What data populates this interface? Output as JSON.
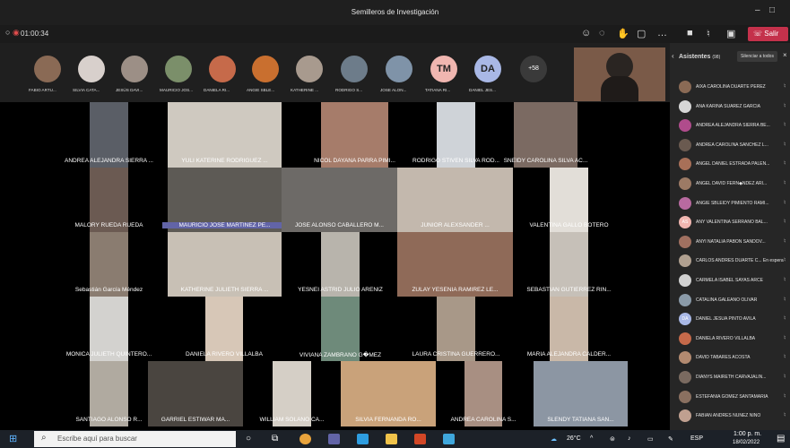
{
  "window": {
    "title": "Semilleros de Investigación"
  },
  "meeting": {
    "timer": "01:00:34",
    "leave_label": "Salir"
  },
  "strip": {
    "avatars": [
      {
        "label": "FABIO ARTU...",
        "color": "#8a6a55"
      },
      {
        "label": "SILVIA CATA...",
        "color": "#d8d0cc"
      },
      {
        "label": "JESÚS DAVI...",
        "color": "#9c8f86"
      },
      {
        "label": "MAURICIO JOS...",
        "color": "#7b8f6a"
      },
      {
        "label": "DANIELA RI...",
        "color": "#c66a4a"
      },
      {
        "label": "ANGIE SBLE...",
        "color": "#c96f2f"
      },
      {
        "label": "KATHERINE ...",
        "color": "#a89a8e"
      },
      {
        "label": "RODRIGO S...",
        "color": "#6d7c8a"
      },
      {
        "label": "JOSE ALON...",
        "color": "#7f93a8"
      },
      {
        "label": "TATIANA RI...",
        "initials": "TM",
        "color": "#f0b6b0"
      },
      {
        "label": "DANIEL JES...",
        "initials": "DA",
        "color": "#a9b8e6"
      }
    ],
    "more_count": "+58"
  },
  "tiles": [
    {
      "name": "ANDREA ALEJANDRA SIERRA ...",
      "color": "#5a5e66"
    },
    {
      "name": "YULI KATERINE RODRIGUEZ ...",
      "color": "#cfc9c0"
    },
    {
      "name": "NICOL DAYANA PARRA PIMI...",
      "color": "#a67c6a"
    },
    {
      "name": "RODRIGO STIVEN SILVA ROD...",
      "color": "#cfd3d8"
    },
    {
      "name": "SNEIDY CAROLINA SILVA AC...",
      "color": "#7b6a62"
    },
    {
      "name": "MALORY  RUEDA RUEDA",
      "color": "#6b5a52"
    },
    {
      "name": "MAURICIO JOSE MARTINEZ PE...",
      "color": "#5d5a55",
      "hl": true
    },
    {
      "name": "JOSE ALONSO CABALLERO M...",
      "color": "#6d6a67"
    },
    {
      "name": "JUNIOR ALEXSANDER ...",
      "color": "#c3b8ad"
    },
    {
      "name": "VALENTINA  GALLO BOTERO",
      "color": "#e2ded8"
    },
    {
      "name": "Sebastián  García Méndez",
      "color": "#8a7c70"
    },
    {
      "name": "KATHERINE JULIETH SIERRA ...",
      "color": "#c8c0b5"
    },
    {
      "name": "YESNEI ASTRID JULIO ARENIZ",
      "color": "#b8b4ac"
    },
    {
      "name": "ZULAY YESENIA RAMIREZ LE...",
      "color": "#8f6a58"
    },
    {
      "name": "SEBASTIAN  GUTIERREZ RIN...",
      "color": "#c6c0b8"
    },
    {
      "name": "MONICA JULIETH QUINTERO...",
      "color": "#d3d2cf"
    },
    {
      "name": "DANIELA  RIVERO VILLALBA",
      "color": "#d7c7b7"
    },
    {
      "name": "VIVIANA  ZAMBRANO G�MEZ",
      "color": "#6e8a7a"
    },
    {
      "name": "LAURA CRISTINA GUERRERO...",
      "color": "#a89888"
    },
    {
      "name": "MARIA ALEJANDRA CALDER...",
      "color": "#c9b8a8"
    },
    {
      "name": "SANTIAGO ALONSO R...",
      "color": "#b0aaa0"
    },
    {
      "name": "GARRIEL ESTIWAR MA...",
      "color": "#4a4540"
    },
    {
      "name": "WILLIAM  SOLANO CA...",
      "color": "#d5cfc6"
    },
    {
      "name": "SILVIA FERNANDA RO...",
      "color": "#c9a27a"
    },
    {
      "name": "ANDREA CAROLINA S...",
      "color": "#a88f82"
    },
    {
      "name": "SLENDY TATIANA SAN...",
      "color": "#8c96a3"
    }
  ],
  "participants_panel": {
    "title": "Asistentes",
    "count": "(98)",
    "mute_all_label": "Silenciar a todos",
    "people": [
      {
        "name": "AIXA CAROLINA DUARTE PEREZ"
      },
      {
        "name": "ANA KARINA SUAREZ GARCIA"
      },
      {
        "name": "ANDREA ALEJANDRA SIERRA BE..."
      },
      {
        "name": "ANDREA CAROLINA SANCHEZ L..."
      },
      {
        "name": "ANGEL DANIEL ESTRADA PALEN..."
      },
      {
        "name": "ANGEL DAVID FERN◆NDEZ ARI..."
      },
      {
        "name": "ANGIE SBLEIDY PIMIENTO RAMI..."
      },
      {
        "name": "ANY VALENTINA SERRANO BAL...",
        "initials": "AS"
      },
      {
        "name": "ANYI NATALIA PABON SANDOV..."
      },
      {
        "name": "CARLOS ANDRES DUARTE C... En espera"
      },
      {
        "name": "CARMELA ISABEL SAYAS ARCE"
      },
      {
        "name": "CATALINA GALEANO OLIVAR"
      },
      {
        "name": "DANIEL JESUA PINTO AVILA",
        "initials": "DA"
      },
      {
        "name": "DANIELA RIVERO VILLALBA"
      },
      {
        "name": "DAVID TABARES ACOSTA"
      },
      {
        "name": "DIANYS MAIRETH CARVAJALIN..."
      },
      {
        "name": "ESTEFANIA GOMEZ SANTAMARIA"
      },
      {
        "name": "FABIAN ANDRES NUÑEZ NIÑO"
      }
    ]
  },
  "taskbar": {
    "search_placeholder": "Escribe aquí para buscar",
    "temperature": "26°C",
    "language": "ESP",
    "time": "1:00 p. m.",
    "date": "18/02/2022"
  }
}
